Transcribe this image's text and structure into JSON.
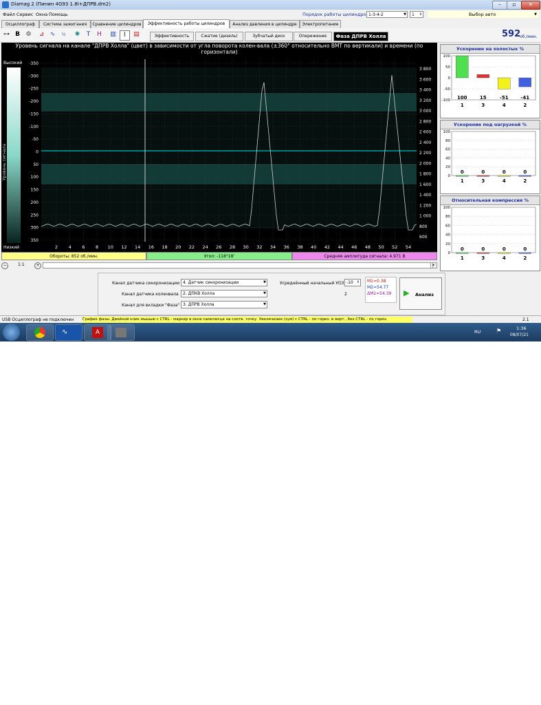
{
  "window": {
    "title": "Diamag 2 (Пинин 4G93 1.8l+ДПРВ.dm2)"
  },
  "menu": [
    "Файл",
    "Сервис",
    "Окна",
    "Помощь"
  ],
  "cylinder_order": {
    "label": "Порядок работы цилиндров",
    "value": "1-3-4-2",
    "spin": "1"
  },
  "auto_select": "Выбор авто",
  "tabs": [
    "Осциллограф",
    "Система зажигания",
    "Сравнение цилиндров",
    "Эффективность работы цилиндров",
    "Анализ давления в цилиндре",
    "Электропитание"
  ],
  "toolbar_icons": [
    "trigger-icon",
    "b-icon",
    "gear-icon",
    "graph-icon",
    "wave-icon",
    "fraction-icon",
    "sun-icon",
    "t-icon",
    "h-icon",
    "bars-icon",
    "scope-icon",
    "chart-icon"
  ],
  "subtabs": [
    "Эффективность",
    "Сжатие (дизель)",
    "Зубчатый диск",
    "Опережение",
    "Фаза ДПРВ Холла"
  ],
  "rpm": {
    "value": "592",
    "unit": "об./мин."
  },
  "main_chart": {
    "title": "Уровень сигнала на канале \"ДПРВ Холла\" (цвет) в зависимости от угла поворота колен-вала (±360° относительно ВМТ по вертикали) и времени (по горизонтали)",
    "legend_high": "Высокий",
    "legend_low": "Низкий",
    "legend_label": "Уровень сигнала",
    "y_left_ticks": [
      "-350",
      "-300",
      "-250",
      "-200",
      "-150",
      "-100",
      "-50",
      "0",
      "50",
      "100",
      "150",
      "200",
      "250",
      "300",
      "350"
    ],
    "y_right_ticks": [
      "3 800",
      "3 600",
      "3 400",
      "3 200",
      "3 000",
      "2 800",
      "2 600",
      "2 400",
      "2 200",
      "2 000",
      "1 800",
      "1 600",
      "1 400",
      "1 200",
      "1 000",
      "800",
      "600"
    ],
    "x_ticks": [
      "2",
      "4",
      "6",
      "8",
      "10",
      "12",
      "14",
      "16",
      "18",
      "20",
      "22",
      "24",
      "26",
      "28",
      "30",
      "32",
      "34",
      "36",
      "38",
      "40",
      "42",
      "44",
      "46",
      "48",
      "50",
      "52",
      "54"
    ]
  },
  "status_bars": {
    "rpm": "Обороты: 852 об./мин.",
    "angle": "Угол: -118°18'",
    "amplitude": "Средняя амплитуда сигнала: 4.971 В"
  },
  "zoom": "1:1",
  "panels": [
    {
      "title": "Ускорение на холостых %",
      "y_ticks": [
        "100",
        "50",
        "0",
        "-50",
        "-100"
      ],
      "cyl": [
        "1",
        "3",
        "4",
        "2"
      ],
      "values": [
        "100",
        "15",
        "-51",
        "-41"
      ]
    },
    {
      "title": "Ускорение под нагрузкой %",
      "y_ticks": [
        "100",
        "80",
        "60",
        "40",
        "20",
        "0"
      ],
      "cyl": [
        "1",
        "3",
        "4",
        "2"
      ],
      "values": [
        "0",
        "0",
        "0",
        "0"
      ]
    },
    {
      "title": "Относительная компрессия %",
      "y_ticks": [
        "100",
        "80",
        "60",
        "40",
        "20",
        "0"
      ],
      "cyl": [
        "1",
        "3",
        "4",
        "2"
      ],
      "values": [
        "0",
        "0",
        "0",
        "0"
      ]
    }
  ],
  "controls": {
    "sync_label": "Канал датчика синхронизации",
    "sync_value": "4. Датчик синхронизации",
    "crank_label": "Канал датчика коленвала",
    "crank_value": "2. ДПКВ Холла",
    "phase_label": "Канал для вкладки \"Фаза\"",
    "phase_value": "3. ДПРВ Холла",
    "uoz_label": "Усреднённый начальный УОЗ",
    "uoz_value": "-10",
    "uoz_count": "2",
    "m1": "M1=0.38",
    "m2": "M2=54.77",
    "dm1": "ΔM1=54.39",
    "analyze": "Анализ"
  },
  "statusbar": {
    "left": "USB Осциллограф не подключен",
    "hint": "График фазы. Двойной клик мышью с CTRL - маркер в окне самописца на соотв. точку. Увеличение (зум) с CTRL - по гориз. и верт., без CTRL - по гориз.",
    "version": "2.1"
  },
  "taskbar": {
    "lang": "RU",
    "time": "1:36",
    "date": "08/07/21"
  },
  "colors": {
    "cyl1": "#4ee04e",
    "cyl3": "#e03030",
    "cyl4": "#f2f21a",
    "cyl2": "#4060e0",
    "cyan": "#00ffff"
  }
}
